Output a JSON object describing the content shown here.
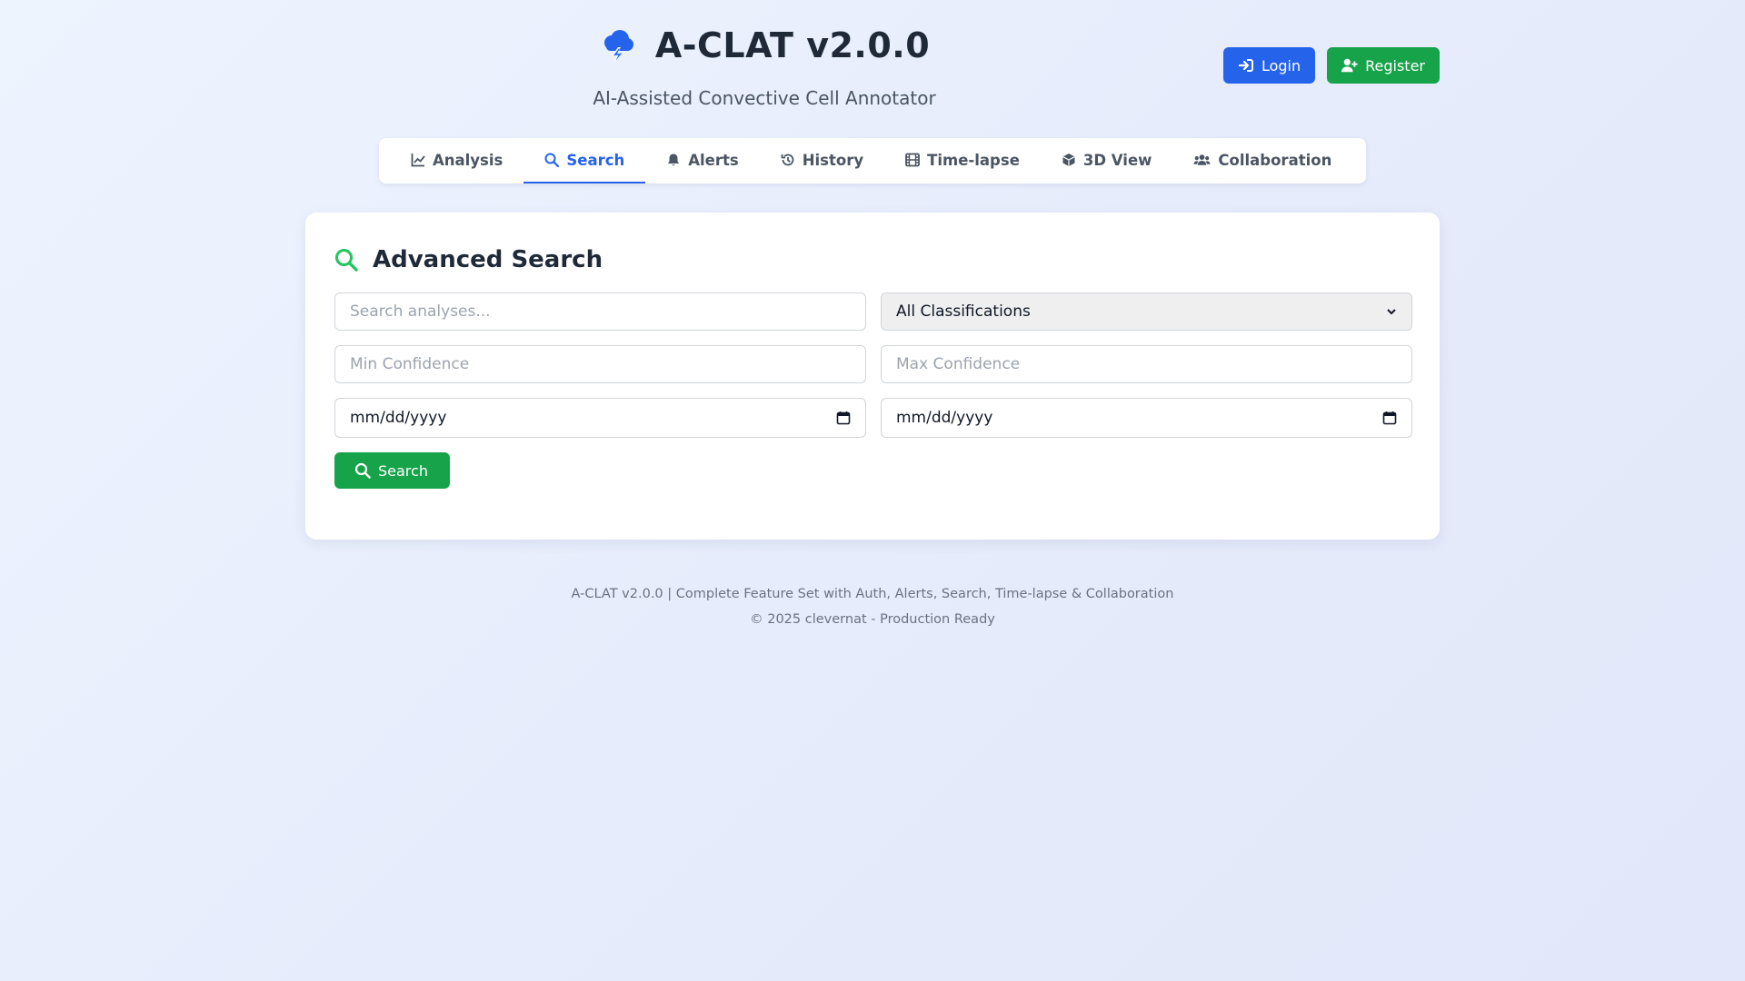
{
  "app": {
    "title": "A-CLAT v2.0.0",
    "subtitle": "AI-Assisted Convective Cell Annotator",
    "logo_icon": "cloud-bolt-icon"
  },
  "auth": {
    "login_label": "Login",
    "register_label": "Register"
  },
  "tabs": [
    {
      "label": "Analysis",
      "icon": "chart-line-icon",
      "active": false
    },
    {
      "label": "Search",
      "icon": "search-icon",
      "active": true
    },
    {
      "label": "Alerts",
      "icon": "bell-icon",
      "active": false
    },
    {
      "label": "History",
      "icon": "history-icon",
      "active": false
    },
    {
      "label": "Time-lapse",
      "icon": "film-icon",
      "active": false
    },
    {
      "label": "3D View",
      "icon": "cube-icon",
      "active": false
    },
    {
      "label": "Collaboration",
      "icon": "users-icon",
      "active": false
    }
  ],
  "search": {
    "title": "Advanced Search",
    "query_placeholder": "Search analyses...",
    "classification_value": "All Classifications",
    "min_conf_placeholder": "Min Confidence",
    "max_conf_placeholder": "Max Confidence",
    "date_from_value": "mm/dd/yyyy",
    "date_to_value": "mm/dd/yyyy",
    "button_label": "Search"
  },
  "footer": {
    "line1": "A-CLAT v2.0.0 | Complete Feature Set with Auth, Alerts, Search, Time-lapse & Collaboration",
    "line2": "© 2025 clevernat - Production Ready"
  },
  "colors": {
    "primary": "#2563eb",
    "success": "#16a34a",
    "text": "#1f2937"
  }
}
